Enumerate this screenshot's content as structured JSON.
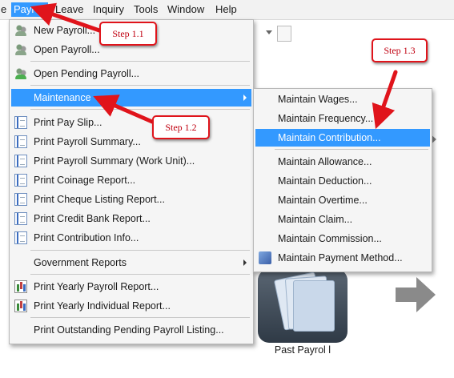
{
  "menubar": {
    "items": [
      "e",
      "Payroll",
      "Leave",
      "Inquiry",
      "Tools",
      "Window",
      "Help"
    ],
    "active": "Payroll"
  },
  "payroll_menu": {
    "items": [
      "New Payroll...",
      "Open Payroll...",
      "Open Pending Payroll...",
      "Maintenance",
      "Print Pay Slip...",
      "Print Payroll Summary...",
      "Print Payroll Summary (Work Unit)...",
      "Print Coinage Report...",
      "Print Cheque Listing Report...",
      "Print Credit Bank Report...",
      "Print Contribution Info...",
      "Government Reports",
      "Print Yearly Payroll Report...",
      "Print Yearly Individual Report...",
      "Print Outstanding Pending Payroll Listing..."
    ]
  },
  "maintenance_submenu": {
    "items": [
      "Maintain Wages...",
      "Maintain Frequency...",
      "Maintain Contribution...",
      "Maintain Allowance...",
      "Maintain Deduction...",
      "Maintain Overtime...",
      "Maintain Claim...",
      "Maintain Commission...",
      "Maintain Payment Method..."
    ],
    "highlighted": "Maintain Contribution..."
  },
  "callouts": {
    "step1": "Step 1.1",
    "step2": "Step 1.2",
    "step3": "Step 1.3"
  },
  "background": {
    "folder_label": "Past Payrol l"
  },
  "colors": {
    "highlight": "#3399ff",
    "callout_red": "#e0141b"
  }
}
